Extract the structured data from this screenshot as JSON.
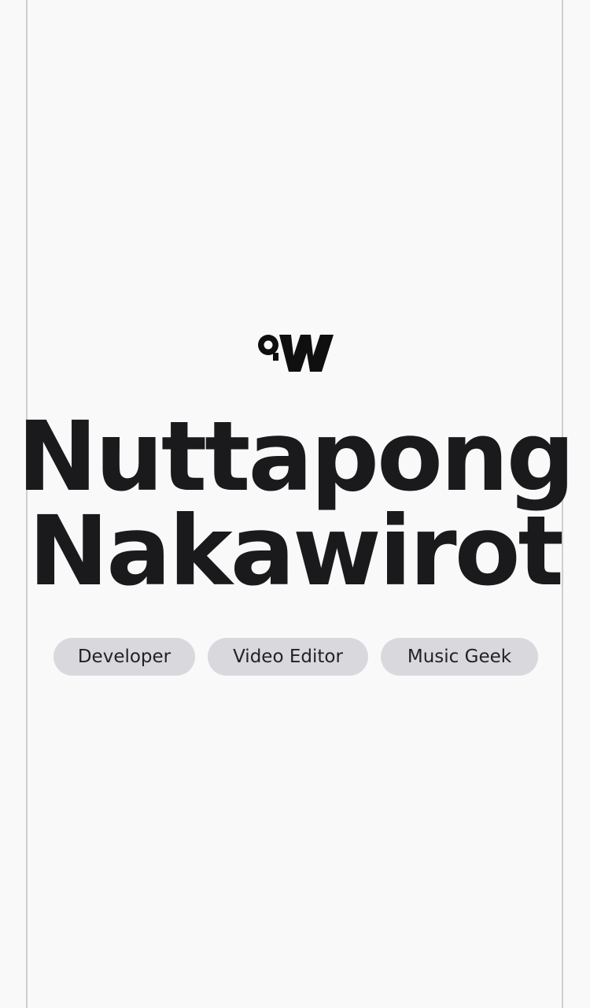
{
  "brand": {
    "logo_icon": "ow-monogram-icon"
  },
  "hero": {
    "name_line_1": "Nuttapong",
    "name_line_2": "Nakawirot"
  },
  "tags": [
    {
      "label": "Developer"
    },
    {
      "label": "Video Editor"
    },
    {
      "label": "Music Geek"
    }
  ],
  "colors": {
    "background": "#f9f9f9",
    "text": "#1a1a1c",
    "tag_background": "#d9d8dd",
    "frame_border": "#cfcfd2"
  }
}
